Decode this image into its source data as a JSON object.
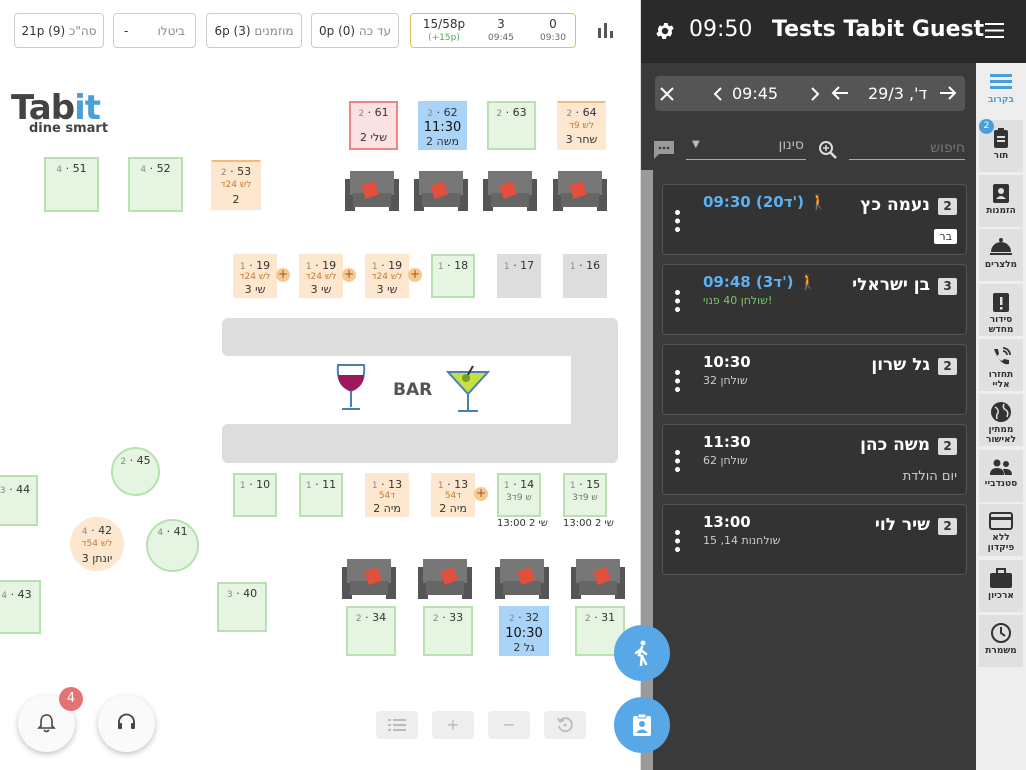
{
  "topbar": {
    "total": {
      "label": "סה\"כ",
      "value": "21p (9)"
    },
    "cancelled": {
      "label": "ביטלו",
      "value": "-"
    },
    "invited": {
      "label": "מוזמנים",
      "value": "6p (3)"
    },
    "until": {
      "label": "עד כה",
      "value": "0p (0)"
    },
    "stats": [
      {
        "top": "0",
        "bottom": "09:30"
      },
      {
        "top": "3",
        "bottom": "09:45"
      },
      {
        "top": "15/58p",
        "bottom": "(+15p)"
      }
    ]
  },
  "logo": {
    "main_a": "Tab",
    "main_b": "it",
    "sub": "dine smart"
  },
  "bar_label": "BAR",
  "tables": [
    {
      "id": "t61",
      "num": "61",
      "cap": "2",
      "name": "שלי 2"
    },
    {
      "id": "t62",
      "num": "62",
      "cap": "2",
      "time": "11:30",
      "name": "משה 2"
    },
    {
      "id": "t63",
      "num": "63",
      "cap": "2"
    },
    {
      "id": "t64",
      "num": "64",
      "cap": "2",
      "l2": "לש 9ד",
      "name": "שחר 3"
    },
    {
      "id": "t51",
      "num": "51",
      "cap": "4"
    },
    {
      "id": "t52",
      "num": "52",
      "cap": "4"
    },
    {
      "id": "t53",
      "num": "53",
      "cap": "2",
      "l2": "לש 24ד",
      "name": "2"
    },
    {
      "id": "t19a",
      "num": "19",
      "cap": "1",
      "l2": "לש 24ד",
      "name": "שי 3"
    },
    {
      "id": "t19b",
      "num": "19",
      "cap": "1",
      "l2": "לש 24ד",
      "name": "שי 3"
    },
    {
      "id": "t19c",
      "num": "19",
      "cap": "1",
      "l2": "לש 24ד",
      "name": "שי 3"
    },
    {
      "id": "t18",
      "num": "18",
      "cap": "1"
    },
    {
      "id": "t17",
      "num": "17",
      "cap": "1"
    },
    {
      "id": "t16",
      "num": "16",
      "cap": "1"
    },
    {
      "id": "t45",
      "num": "45",
      "cap": "2"
    },
    {
      "id": "t44",
      "num": "44",
      "cap": "3"
    },
    {
      "id": "t42",
      "num": "42",
      "cap": "4",
      "l2": "לש 54ד",
      "name": "יונתן 3"
    },
    {
      "id": "t41",
      "num": "41",
      "cap": "4"
    },
    {
      "id": "t43",
      "num": "43",
      "cap": "4"
    },
    {
      "id": "t40",
      "num": "40",
      "cap": "3"
    },
    {
      "id": "t10",
      "num": "10",
      "cap": "1"
    },
    {
      "id": "t11",
      "num": "11",
      "cap": "1"
    },
    {
      "id": "t13a",
      "num": "13",
      "cap": "1",
      "l2": "54ד",
      "name": "מיה 2"
    },
    {
      "id": "t13b",
      "num": "13",
      "cap": "1",
      "l2": "54ד",
      "name": "מיה 2"
    },
    {
      "id": "t14",
      "num": "14",
      "cap": "1",
      "l2": "3ש 9ד",
      "under": "13:00 שי 2"
    },
    {
      "id": "t15",
      "num": "15",
      "cap": "1",
      "l2": "3ש 9ד",
      "under": "13:00 שי 2"
    },
    {
      "id": "t34",
      "num": "34",
      "cap": "2"
    },
    {
      "id": "t33",
      "num": "33",
      "cap": "2"
    },
    {
      "id": "t32",
      "num": "32",
      "cap": "2",
      "time": "10:30",
      "name": "גל 2"
    },
    {
      "id": "t31",
      "num": "31",
      "cap": "2"
    }
  ],
  "bell_badge": "4",
  "header": {
    "time": "09:50",
    "restaurant": "Tests Tabit Guest"
  },
  "datebar": {
    "date": "ד', 29/3",
    "time": "09:45"
  },
  "search": {
    "placeholder": "חיפוש",
    "filter_label": "סינון"
  },
  "reservations": [
    {
      "name": "נעמה כץ",
      "count": "2",
      "time": "09:30 (20ד')",
      "tag": "בר"
    },
    {
      "name": "בן ישראלי",
      "count": "3",
      "time": "09:48 (3ד')",
      "sub": "שולחן 40 פנוי!"
    },
    {
      "name": "גל שרון",
      "count": "2",
      "time": "10:30",
      "sub": "שולחן 32"
    },
    {
      "name": "משה כהן",
      "count": "2",
      "time": "11:30",
      "sub": "שולחן 62",
      "note": "יום הולדת"
    },
    {
      "name": "שיר לוי",
      "count": "2",
      "time": "13:00",
      "sub": "שולחנות 14, 15"
    }
  ],
  "nav": [
    {
      "label": "בקרוב"
    },
    {
      "label": "תור",
      "badge": "2"
    },
    {
      "label": "הזמנות"
    },
    {
      "label": "מלצרים"
    },
    {
      "label": "סידור מחדש"
    },
    {
      "label": "תחזרו אליי"
    },
    {
      "label": "ממתין לאישור"
    },
    {
      "label": "סטנדביי"
    },
    {
      "label": "ללא פיקדון"
    },
    {
      "label": "ארכיון"
    },
    {
      "label": "משמרת"
    }
  ],
  "colors": {
    "accent": "#58a7e6",
    "panel": "#3a3a3a",
    "green_table": "#e6f4e2",
    "orange_table": "#fde7cf"
  }
}
